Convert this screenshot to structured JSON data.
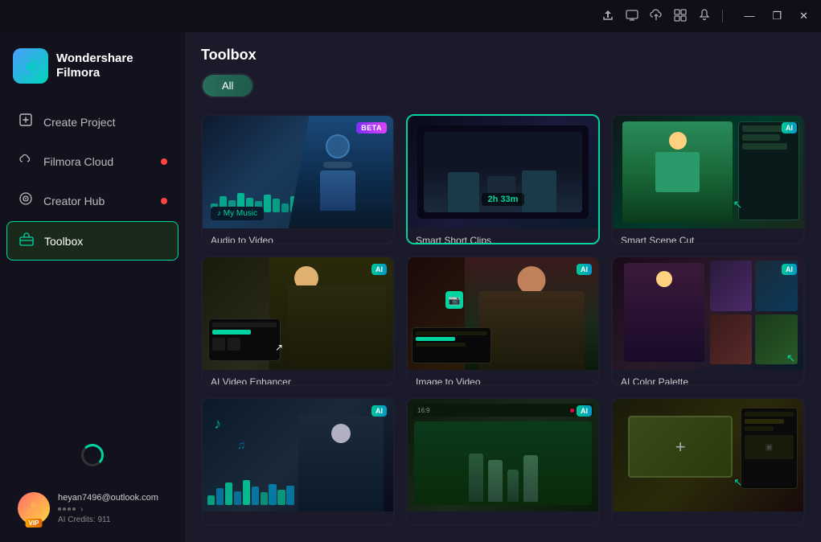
{
  "app": {
    "name": "Wondershare",
    "name2": "Filmora",
    "logo_emoji": "🎬"
  },
  "titlebar": {
    "icons": [
      "share",
      "monitor",
      "cloud-up",
      "grid",
      "bell"
    ],
    "minimize": "—",
    "maximize": "❐",
    "close": "✕"
  },
  "sidebar": {
    "items": [
      {
        "id": "create-project",
        "label": "Create Project",
        "icon": "⊕",
        "dot": false
      },
      {
        "id": "filmora-cloud",
        "label": "Filmora Cloud",
        "icon": "☁",
        "dot": true
      },
      {
        "id": "creator-hub",
        "label": "Creator Hub",
        "icon": "◎",
        "dot": true
      },
      {
        "id": "toolbox",
        "label": "Toolbox",
        "icon": "🧰",
        "dot": false,
        "active": true
      }
    ],
    "user": {
      "email": "heyan7496@outlook.com",
      "credits_label": "AI Credits: 911",
      "vip": "VIP"
    }
  },
  "main": {
    "title": "Toolbox",
    "filter_tabs": [
      {
        "label": "All",
        "active": true
      }
    ],
    "tools": [
      {
        "id": "audio-to-video",
        "label": "Audio to Video",
        "badge": "BETA",
        "selected": false
      },
      {
        "id": "smart-short-clips",
        "label": "Smart Short Clips",
        "badge": null,
        "selected": true,
        "timer": "2h 33m"
      },
      {
        "id": "smart-scene-cut",
        "label": "Smart Scene Cut",
        "badge": "AI",
        "selected": false
      },
      {
        "id": "ai-video-enhancer",
        "label": "AI Video Enhancer",
        "badge": "AI",
        "selected": false
      },
      {
        "id": "image-to-video",
        "label": "Image to Video",
        "badge": "AI",
        "selected": false
      },
      {
        "id": "ai-color-palette",
        "label": "AI Color Palette",
        "badge": "AI",
        "selected": false
      },
      {
        "id": "bottom-tool-1",
        "label": "",
        "badge": "AI",
        "selected": false
      },
      {
        "id": "bottom-tool-2",
        "label": "",
        "badge": "AI",
        "selected": false
      },
      {
        "id": "bottom-tool-3",
        "label": "",
        "badge": null,
        "selected": false
      }
    ]
  }
}
